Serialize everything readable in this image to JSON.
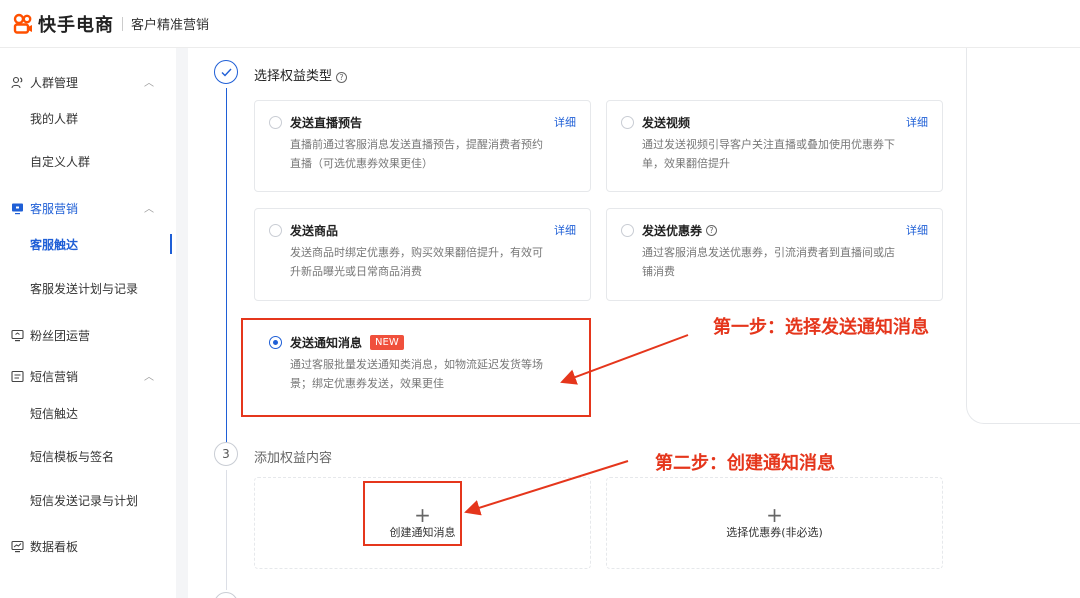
{
  "header": {
    "brand": "快手电商",
    "subtitle": "客户精准营销"
  },
  "sidebar": {
    "groups": [
      {
        "label": "人群管理",
        "icon": "people-icon",
        "items": [
          "我的人群",
          "自定义人群"
        ]
      },
      {
        "label": "客服营销",
        "icon": "service-icon",
        "items": [
          "客服触达",
          "客服发送计划与记录"
        ]
      },
      {
        "label": "粉丝团运营",
        "icon": "fans-icon",
        "items": []
      },
      {
        "label": "短信营销",
        "icon": "sms-icon",
        "items": [
          "短信触达",
          "短信模板与签名",
          "短信发送记录与计划"
        ]
      },
      {
        "label": "数据看板",
        "icon": "chart-icon",
        "items": []
      }
    ],
    "active_item": "客服触达"
  },
  "step2": {
    "title": "选择权益类型",
    "cards": [
      {
        "title": "发送直播预告",
        "link": "详细",
        "desc_line1": "直播前通过客服消息发送直播预告，提醒消费者预约",
        "desc_line2": "直播（可选优惠券效果更佳）"
      },
      {
        "title": "发送视频",
        "link": "详细",
        "desc_line1": "通过发送视频引导客户关注直播或叠加使用优惠券下",
        "desc_line2": "单，效果翻倍提升"
      },
      {
        "title": "发送商品",
        "link": "详细",
        "desc_line1": "发送商品时绑定优惠券，购买效果翻倍提升，有效可",
        "desc_line2": "升新品曝光或日常商品消费"
      },
      {
        "title": "发送优惠券",
        "link": "详细",
        "desc_line1": "通过客服消息发送优惠券，引流消费者到直播间或店",
        "desc_line2": "铺消费"
      },
      {
        "title": "发送通知消息",
        "badge": "NEW",
        "desc_line1": "通过客服批量发送通知类消息，如物流延迟发货等场",
        "desc_line2": "景；绑定优惠券发送，效果更佳"
      }
    ]
  },
  "step3": {
    "number": "3",
    "title": "添加权益内容",
    "create_label": "创建通知消息",
    "coupon_label": "选择优惠券(非必选)"
  },
  "annotations": {
    "step1": "第一步：选择发送通知消息",
    "step2": "第二步：创建通知消息"
  },
  "colors": {
    "accent": "#1f5fd6",
    "annotation": "#e5361c",
    "brand": "#ff5000"
  }
}
